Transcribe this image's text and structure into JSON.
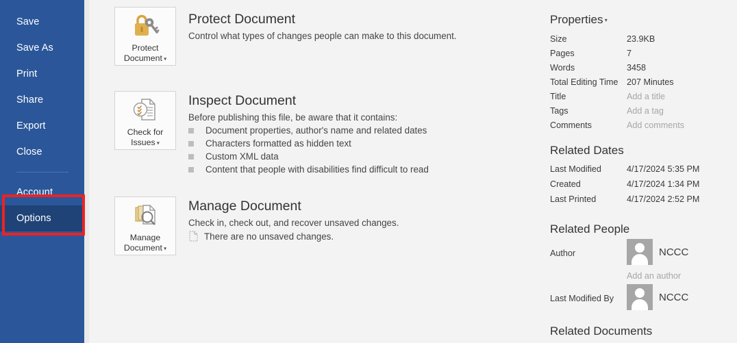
{
  "colors": {
    "sidebar_blue": "#2b579a",
    "sidebar_highlight": "#1f4377",
    "annotation_red": "#ee2222",
    "main_background": "#f3f3f3",
    "lock_gold": "#d9a43b",
    "text_dark": "#333333",
    "text_placeholder": "#a6a6a6"
  },
  "sidebar": {
    "items": [
      {
        "label": "Save",
        "state": "normal"
      },
      {
        "label": "Save As",
        "state": "normal"
      },
      {
        "label": "Print",
        "state": "normal"
      },
      {
        "label": "Share",
        "state": "normal"
      },
      {
        "label": "Export",
        "state": "normal"
      },
      {
        "label": "Close",
        "state": "normal"
      },
      {
        "label": "Account",
        "state": "normal"
      },
      {
        "label": "Options",
        "state": "highlighted"
      }
    ]
  },
  "main": {
    "sections": [
      {
        "button_line1": "Protect",
        "button_line2": "Document",
        "icon": "lock-and-key-icon",
        "title": "Protect Document",
        "description": "Control what types of changes people can make to this document.",
        "bullets": []
      },
      {
        "button_line1": "Check for",
        "button_line2": "Issues",
        "icon": "document-checklist-icon",
        "title": "Inspect Document",
        "description": "Before publishing this file, be aware that it contains:",
        "bullets": [
          "Document properties, author's name and related dates",
          "Characters formatted as hidden text",
          "Custom XML data",
          "Content that people with disabilities find difficult to read"
        ]
      },
      {
        "button_line1": "Manage",
        "button_line2": "Document",
        "icon": "documents-magnifier-icon",
        "title": "Manage Document",
        "description": "Check in, check out, and recover unsaved changes.",
        "unsaved_note": "There are no unsaved changes.",
        "bullets": []
      }
    ]
  },
  "properties_panel": {
    "properties": {
      "heading": "Properties",
      "rows": [
        {
          "key": "Size",
          "value": "23.9KB",
          "placeholder": false
        },
        {
          "key": "Pages",
          "value": "7",
          "placeholder": false
        },
        {
          "key": "Words",
          "value": "3458",
          "placeholder": false
        },
        {
          "key": "Total Editing Time",
          "value": "207 Minutes",
          "placeholder": false
        },
        {
          "key": "Title",
          "value": "Add a title",
          "placeholder": true
        },
        {
          "key": "Tags",
          "value": "Add a tag",
          "placeholder": true
        },
        {
          "key": "Comments",
          "value": "Add comments",
          "placeholder": true
        }
      ]
    },
    "related_dates": {
      "heading": "Related Dates",
      "rows": [
        {
          "key": "Last Modified",
          "value": "4/17/2024 5:35 PM"
        },
        {
          "key": "Created",
          "value": "4/17/2024 1:34 PM"
        },
        {
          "key": "Last Printed",
          "value": "4/17/2024 2:52 PM"
        }
      ]
    },
    "related_people": {
      "heading": "Related People",
      "author_key": "Author",
      "author_name": "NCCC",
      "add_author": "Add an author",
      "last_modified_by_key": "Last Modified By",
      "last_modified_by_name": "NCCC"
    },
    "related_documents": {
      "heading": "Related Documents"
    }
  }
}
